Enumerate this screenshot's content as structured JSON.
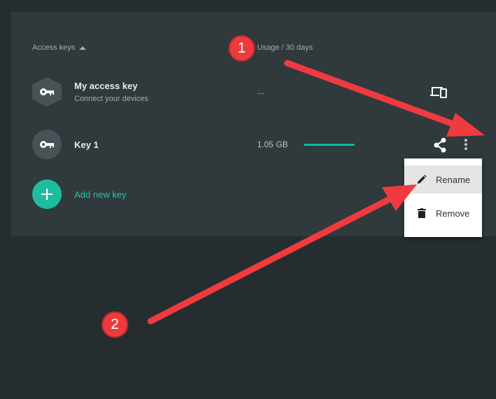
{
  "header": {
    "access_keys_label": "Access keys",
    "usage_label": "Usage / 30 days"
  },
  "keys": [
    {
      "title": "My access key",
      "subtitle": "Connect your devices",
      "usage": "...",
      "icon": "key-icon",
      "action_icon": "devices-icon"
    },
    {
      "title": "Key 1",
      "usage": "1.05 GB",
      "usage_fraction": 1.0,
      "icon": "key-icon",
      "action_icons": [
        "share-icon",
        "more-vert-icon"
      ]
    }
  ],
  "add_key": {
    "label": "Add new key",
    "icon": "plus-icon"
  },
  "context_menu": {
    "items": [
      {
        "label": "Rename",
        "icon": "pencil-icon"
      },
      {
        "label": "Remove",
        "icon": "trash-icon"
      }
    ]
  },
  "annotations": {
    "step1": "1",
    "step2": "2"
  },
  "colors": {
    "background": "#262d30",
    "panel": "#30393c",
    "accent": "#1fbd9e",
    "annotation_red": "#ec3a3d"
  }
}
